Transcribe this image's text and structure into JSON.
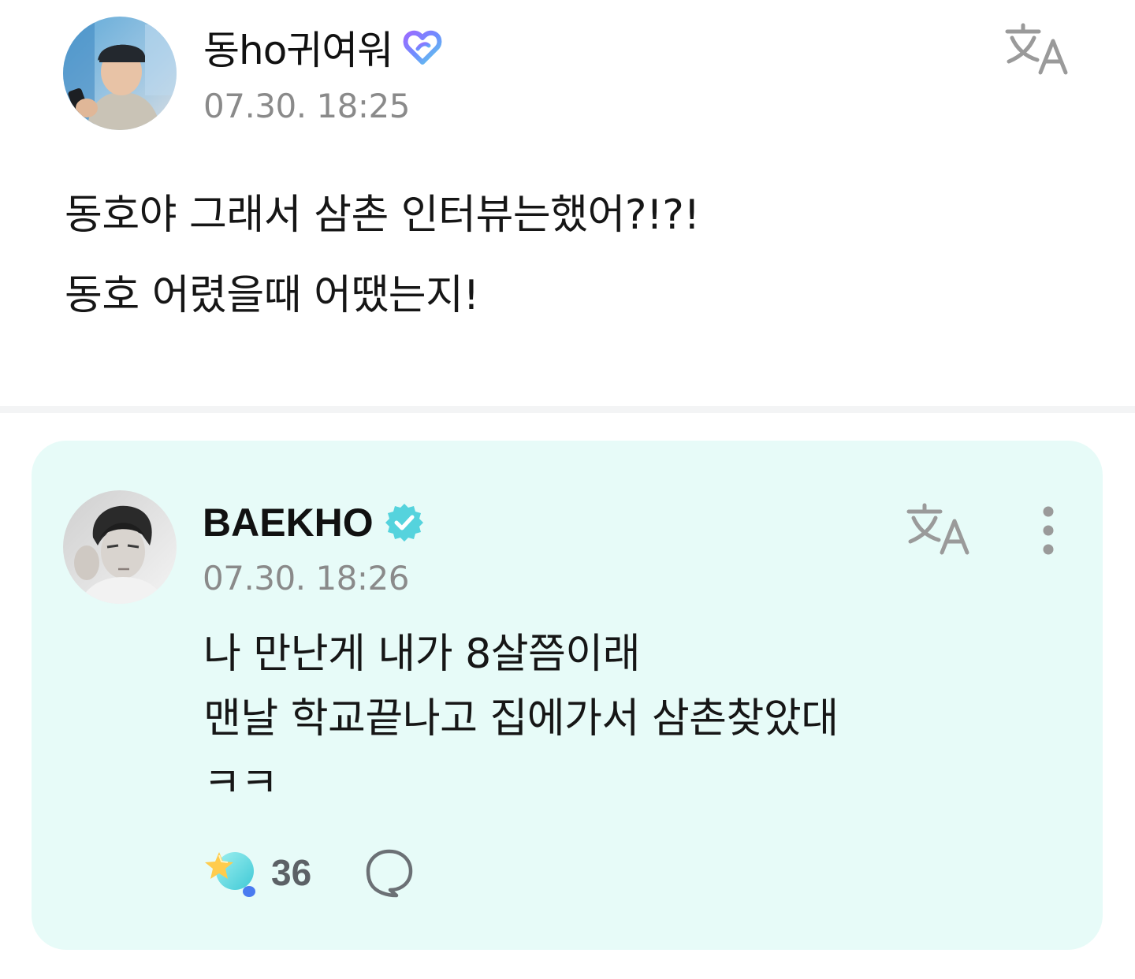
{
  "post": {
    "author": {
      "name": "동ho귀여워",
      "badge_icon": "fan-membership-heart-icon",
      "badge_colors": [
        "#7a8cff",
        "#9b6bff",
        "#5fd0e8"
      ]
    },
    "timestamp": "07.30. 18:25",
    "translate_icon": "translate-icon",
    "body_lines": [
      "동호야 그래서 삼촌 인터뷰는했어?!?!",
      "동호 어렸을때 어땠는지!"
    ]
  },
  "reply": {
    "author": {
      "name": "BAEKHO",
      "badge_icon": "verified-artist-icon",
      "badge_color": "#55d3dd"
    },
    "timestamp": "07.30. 18:26",
    "translate_icon": "translate-icon",
    "more_icon": "more-vertical-icon",
    "body_lines": [
      "나 만난게 내가 8살쯤이래",
      "맨날 학교끝나고 집에가서 삼촌찾았대",
      "ㅋㅋ"
    ],
    "like_icon": "star-bubble-like-icon",
    "like_count": "36",
    "comment_icon": "comment-bubble-icon",
    "card_color": "#e7fbf8"
  }
}
